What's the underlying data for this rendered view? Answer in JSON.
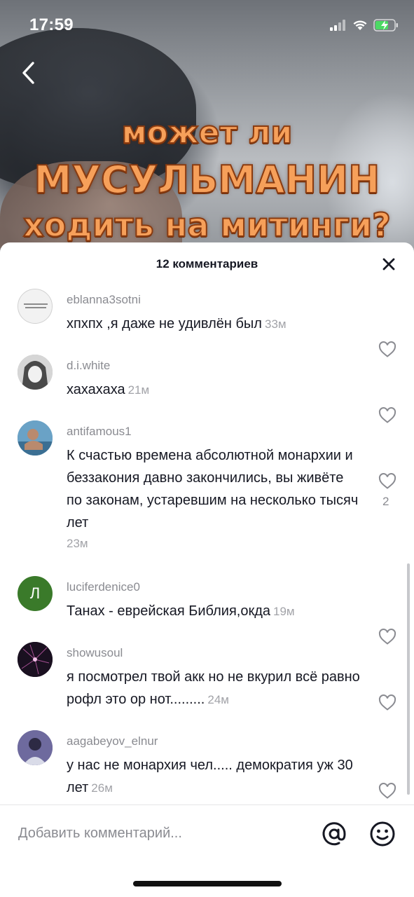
{
  "status_bar": {
    "time": "17:59"
  },
  "video": {
    "overlay_lines": [
      "может ли",
      "МУСУЛЬМАНИН",
      "ходить на митинги?"
    ]
  },
  "comments_sheet": {
    "title": "12 комментариев",
    "comments": [
      {
        "username": "eblanna3sotni",
        "text": "хпхпх ,я даже не удивлён был",
        "time": "33м",
        "likes": ""
      },
      {
        "username": "d.i.white",
        "text": "хахахаха",
        "time": "21м",
        "likes": ""
      },
      {
        "username": "antifamous1",
        "text": "К счастью времена абсолютной монархии и беззакония давно закончились, вы живёте по законам, устаревшим на несколько тысяч лет",
        "time": "23м",
        "likes": "2"
      },
      {
        "username": "luciferdenice0",
        "text": "Танах - еврейская Библия,окда",
        "time": "19м",
        "likes": "",
        "avatar_letter": "Л"
      },
      {
        "username": "showusoul",
        "text": "я посмотрел твой акк но не вкурил всё равно рофл это ор нот.........",
        "time": "24м",
        "likes": ""
      },
      {
        "username": "aagabeyov_elnur",
        "text": "у нас не монархия чел..... демократия уж 30 лет",
        "time": "26м",
        "likes": ""
      }
    ],
    "avatar_colors": [
      "#d9d9d9",
      "#9e9e9e",
      "#5a8fb3",
      "#3a7a2a",
      "#1a1020",
      "#5d5a8a"
    ]
  },
  "input_bar": {
    "placeholder": "Добавить комментарий..."
  },
  "icons": {
    "back": "chevron-left-icon",
    "close": "close-icon",
    "like": "heart-outline-icon",
    "mention": "at-sign-icon",
    "emoji": "smiley-face-icon"
  }
}
